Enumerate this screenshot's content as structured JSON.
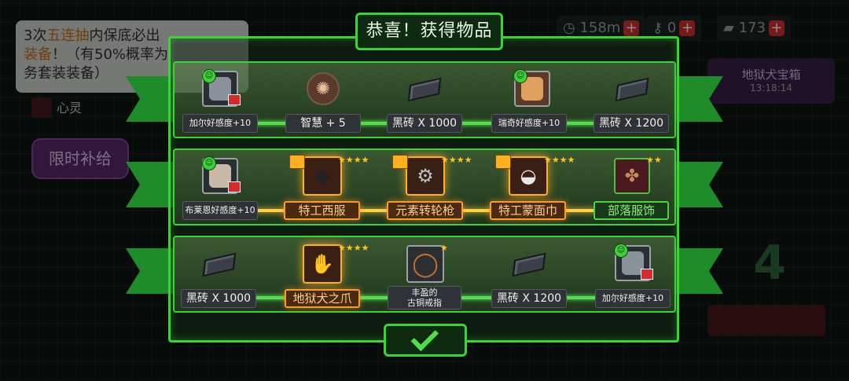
{
  "title": "恭喜！获得物品",
  "hint": {
    "line1_a": "3次",
    "line1_hl": "五连抽",
    "line1_b": "内保底必出",
    "line2_hl": "装备",
    "line2_b": "！（有50%概率为",
    "line3": "务套装装备）"
  },
  "side": {
    "limited": "限时补给",
    "heart_label": "心灵"
  },
  "resources": [
    {
      "icon": "clock-icon",
      "value": "158m"
    },
    {
      "icon": "key-icon",
      "value": "0"
    },
    {
      "icon": "ticket-icon",
      "value": "173"
    }
  ],
  "chest": {
    "title": "地狱犬宝箱",
    "timer": "13:18:14"
  },
  "rows": [
    [
      {
        "icon": "character-portrait-icon",
        "label": "加尔好感度+10"
      },
      {
        "icon": "brain-icon",
        "label": "智慧 + 5"
      },
      {
        "icon": "black-brick-icon",
        "label": "黑砖 X 1000"
      },
      {
        "icon": "cat-portrait-icon",
        "label": "瑞奇好感度+10"
      },
      {
        "icon": "black-brick-icon",
        "label": "黑砖 X 1200"
      }
    ],
    [
      {
        "icon": "old-man-portrait-icon",
        "label": "布莱恩好感度+10"
      },
      {
        "icon": "agent-suit-icon",
        "label": "特工西服"
      },
      {
        "icon": "element-revolver-icon",
        "label": "元素转轮枪"
      },
      {
        "icon": "agent-mask-icon",
        "label": "特工蒙面巾"
      },
      {
        "icon": "tribal-outfit-icon",
        "label": "部落服饰"
      }
    ],
    [
      {
        "icon": "black-brick-icon",
        "label": "黑砖 X 1000"
      },
      {
        "icon": "hellhound-claw-icon",
        "label": "地狱犬之爪"
      },
      {
        "icon": "bronze-ring-icon",
        "label": "丰盈的\n古铜戒指"
      },
      {
        "icon": "black-brick-icon",
        "label": "黑砖 X 1200"
      },
      {
        "icon": "character-portrait-icon",
        "label": "加尔好感度+10"
      }
    ]
  ],
  "colors": {
    "accent": "#3bd437",
    "gold": "#ffb020"
  },
  "confirm_icon": "checkmark-icon"
}
